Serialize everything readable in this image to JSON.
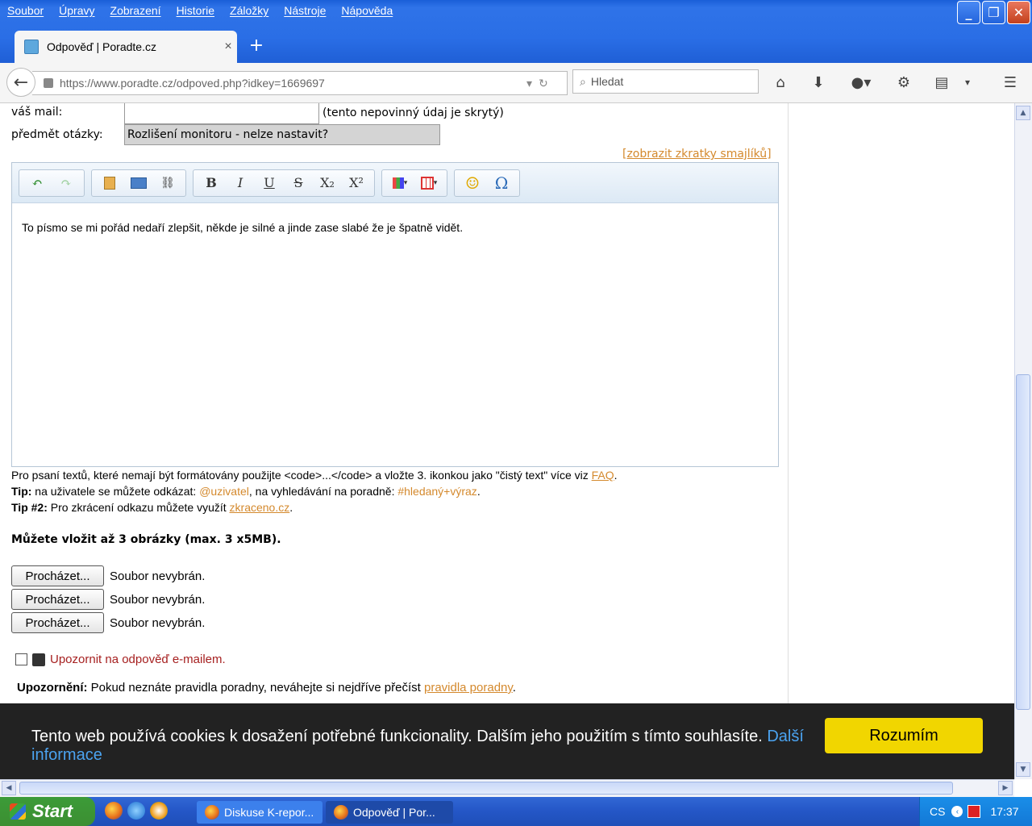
{
  "menu": [
    "Soubor",
    "Úpravy",
    "Zobrazení",
    "Historie",
    "Záložky",
    "Nástroje",
    "Nápověda"
  ],
  "tab": {
    "title": "Odpověď | Poradte.cz",
    "close": "×",
    "new": "+"
  },
  "nav": {
    "url": "https://www.poradte.cz/odpoved.php?idkey=1669697",
    "search_placeholder": "Hledat"
  },
  "form": {
    "mail_label": "váš mail:",
    "mail_note": "(tento nepovinný údaj je skrytý)",
    "subject_label": "předmět otázky:",
    "subject_value": "Rozlišení monitoru - nelze nastavit?",
    "smiley_link": "[zobrazit zkratky smajlíků]"
  },
  "editor": {
    "text": "To písmo se mi pořád nedaří zlepšit, někde je silné a jinde zase slabé že je špatně vidět.",
    "tools": {
      "undo": "↶",
      "redo": "↷",
      "bold": "B",
      "italic": "I",
      "underline": "U",
      "strike": "S",
      "sub": "X₂",
      "sup": "X²",
      "smiley": "☺",
      "omega": "Ω"
    }
  },
  "hints": {
    "line1": "Pro psaní textů, které nemají být formátovány použijte <code>...</code> a vložte 3. ikonkou jako \"čistý text\" více viz ",
    "line1_link": "FAQ",
    "line2_label": "Tip:",
    "line2_a": " na uživatele se můžete odkázat: ",
    "line2_user": "@uzivatel",
    "line2_b": ", na vyhledávání na poradně: ",
    "line2_tag": "#hledaný+výraz",
    "line3_label": "Tip #2:",
    "line3_a": " Pro zkrácení odkazu můžete využít ",
    "line3_link": "zkraceno.cz",
    "images": "Můžete vložit až 3 obrázky (max. 3 x5MB)."
  },
  "files": {
    "button": "Procházet...",
    "status": "Soubor nevybrán."
  },
  "notify": {
    "label": "Upozornit na odpověď e-mailem."
  },
  "warning": {
    "label": "Upozornění:",
    "text": " Pokud neznáte pravidla poradny, neváhejte si nejdříve přečíst ",
    "link": "pravidla poradny"
  },
  "cookie": {
    "text": "Tento web používá cookies k dosažení potřebné funkcionality. Dalším jeho použitím s tímto souhlasíte. ",
    "link": "Další informace",
    "button": "Rozumím"
  },
  "taskbar": {
    "start": "Start",
    "task1": "Diskuse K-repor...",
    "task2": "Odpověď | Por...",
    "lang": "CS",
    "time": "17:37"
  }
}
